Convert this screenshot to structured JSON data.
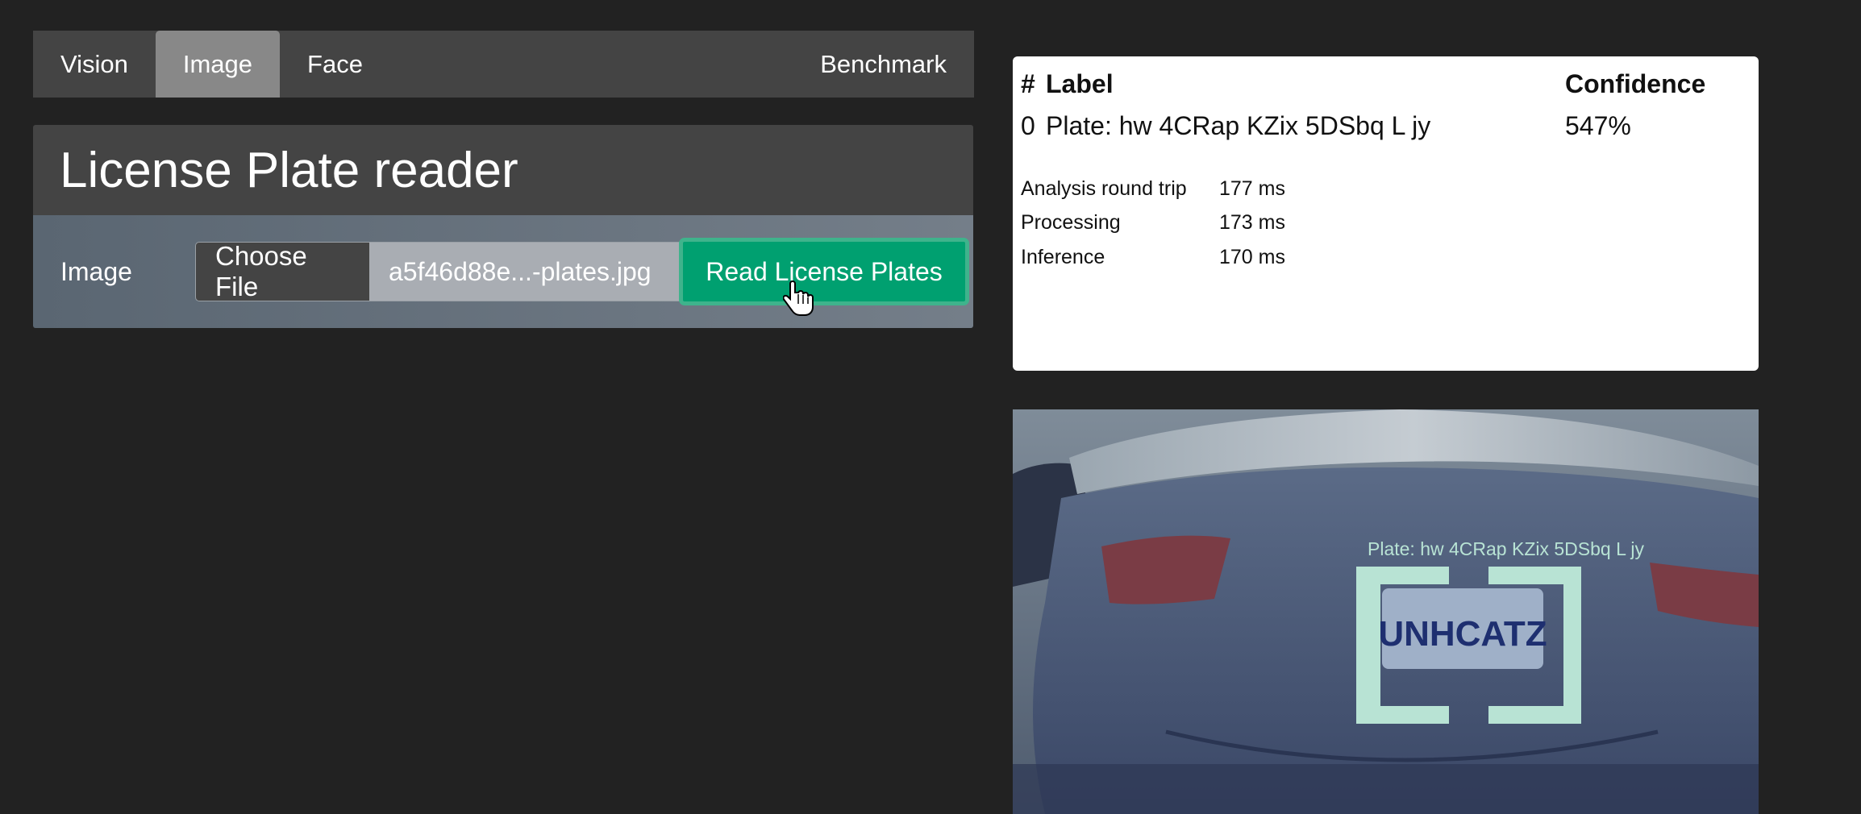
{
  "tabs": [
    {
      "label": "Vision",
      "active": false
    },
    {
      "label": "Image",
      "active": true
    },
    {
      "label": "Face",
      "active": false
    }
  ],
  "benchmark_label": "Benchmark",
  "page_title": "License Plate reader",
  "form": {
    "image_label": "Image",
    "choose_file_label": "Choose File",
    "file_name": "a5f46d88e...-plates.jpg",
    "submit_label": "Read License Plates"
  },
  "results": {
    "headers": {
      "index": "#",
      "label": "Label",
      "confidence": "Confidence"
    },
    "rows": [
      {
        "index": "0",
        "label": "Plate: hw 4CRap KZix 5DSbq L jy",
        "confidence": "547%"
      }
    ],
    "timings": [
      {
        "name": "Analysis round trip",
        "value": "177 ms"
      },
      {
        "name": "Processing",
        "value": "173 ms"
      },
      {
        "name": "Inference",
        "value": "170 ms"
      }
    ]
  },
  "image": {
    "detection_label": "Plate: hw 4CRap KZix 5DSbq L jy",
    "plate_text": "UNHCATZ"
  },
  "colors": {
    "accent": "#00a070",
    "detection_box": "#b8e3d4",
    "background": "#222222",
    "panel": "#444444"
  }
}
